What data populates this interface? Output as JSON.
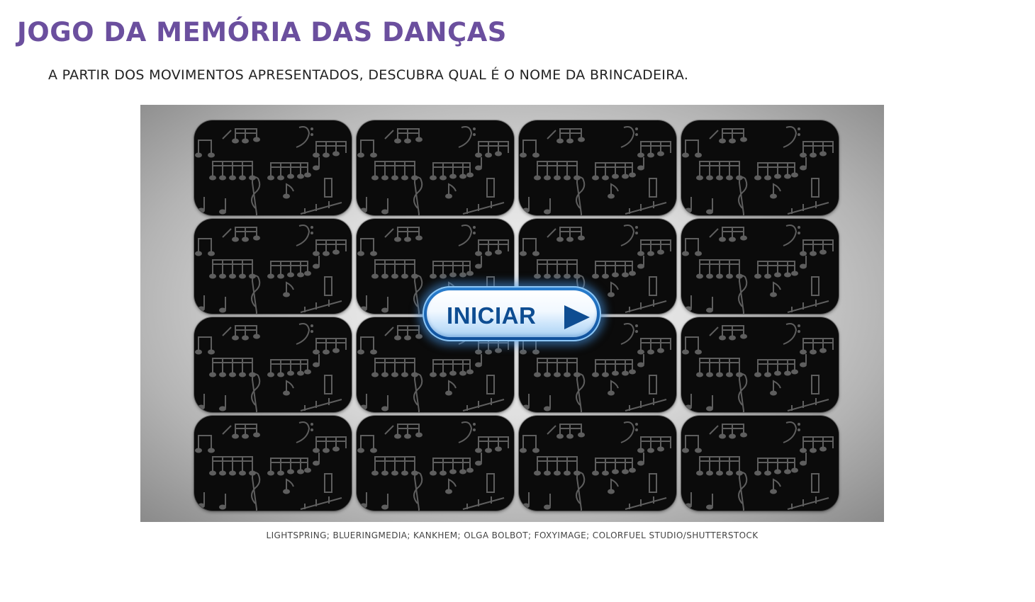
{
  "page": {
    "title": "JOGO DA MEMÓRIA DAS DANÇAS",
    "instructions": "A PARTIR DOS MOVIMENTOS APRESENTADOS, DESCUBRA QUAL É O NOME DA BRINCADEIRA.",
    "credits": "LIGHTSPRING; BLUERINGMEDIA; KANKHEM; OLGA BOLBOT; FOXYIMAGE; COLORFUEL STUDIO/SHUTTERSTOCK"
  },
  "game": {
    "rows": 4,
    "columns": 4,
    "card_back": "music-notes-pattern",
    "start_button_label": "INICIAR",
    "start_button_icon": "play-icon"
  },
  "colors": {
    "title": "#6b4f9e",
    "card_back": "#0b0b0b",
    "card_pattern": "#5e5e5e",
    "button_text": "#0e4d92",
    "button_glow": "#4696e6"
  }
}
